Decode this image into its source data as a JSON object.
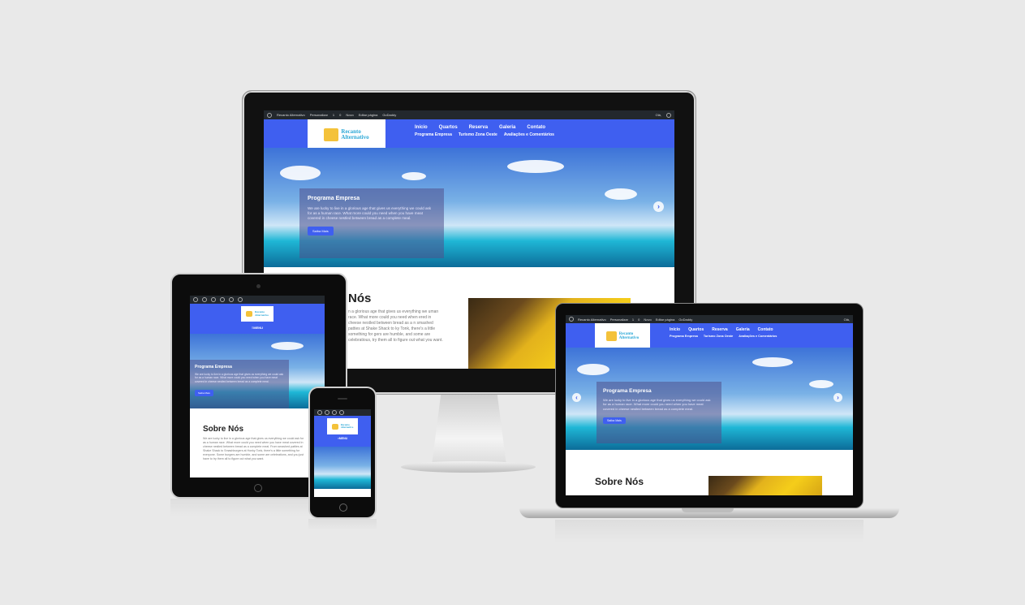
{
  "admin_bar": {
    "site_name": "Recanto Alternativo",
    "customize": "Personalizar",
    "updates": "1",
    "comments": "0",
    "new": "Novo",
    "edit_page": "Editar página",
    "godaddy": "GoDaddy",
    "greeting": "Olá,"
  },
  "site": {
    "logo_line1": "Recanto",
    "logo_line2": "Alternativo",
    "nav_primary": [
      "Início",
      "Quartos",
      "Reserva",
      "Galeria",
      "Contato"
    ],
    "nav_secondary": [
      "Programa Empresa",
      "Turismo Zona Oeste",
      "Avaliações e Comentários"
    ],
    "menu_label": "≡MENU"
  },
  "hero": {
    "title": "Programa Empresa",
    "text": "We are lucky to live in a glorious age that gives us everything we could ask for as a human race. What more could you need when you have meat covered in cheese nestled between bread as a complete meal.",
    "button": "Saiba Mais"
  },
  "about": {
    "title": "Sobre Nós",
    "title_partial": "Nós",
    "text": "We are lucky to live in a glorious age that gives us everything we could ask for as a human race. What more could you need when you have meat covered in cheese nestled between bread as a complete meal. From smashed patties at Shake Shack to Smashburgers at Honky Tonk, there's a little something for everyone. Some burgers are humble, and some are celebrations, and you just have to try them all to figure out what you want.",
    "text_partial": "n a glorious age that gives us everything we uman race. What more could you need when ered in cheese nestled between bread as a n smashed patties at Shake Shack to ky Tonk, there's a little something for gers are humble, and some are celebratious, try them all to figure out what you want."
  },
  "colors": {
    "brand_blue": "#3f5ff0",
    "admin_bar": "#23282d",
    "logo_text": "#2aa7d6"
  }
}
